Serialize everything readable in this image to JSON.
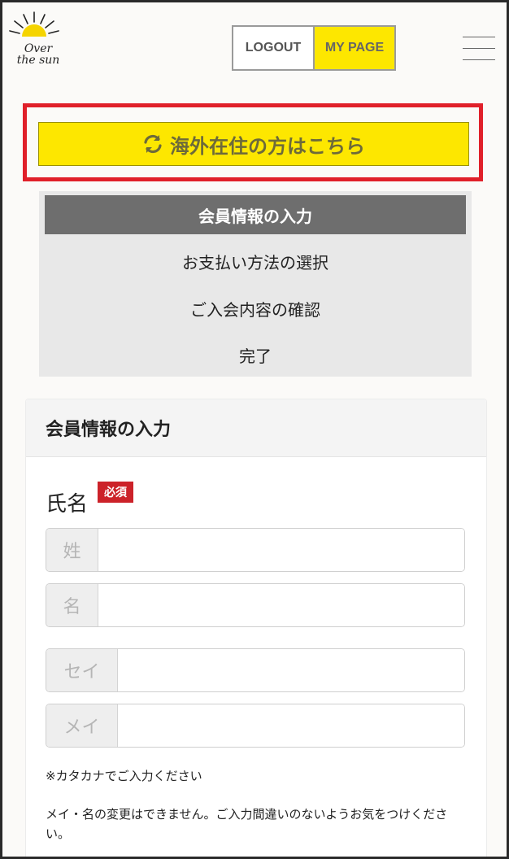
{
  "header": {
    "logo_text": "Over the sun",
    "logout_label": "LOGOUT",
    "mypage_label": "MY PAGE"
  },
  "overseas": {
    "label": "海外在住の方はこちら",
    "icon": "refresh-icon",
    "highlight_color": "#e0202a",
    "button_color": "#fde700"
  },
  "steps": [
    {
      "label": "会員情報の入力",
      "active": true
    },
    {
      "label": "お支払い方法の選択",
      "active": false
    },
    {
      "label": "ご入会内容の確認",
      "active": false
    },
    {
      "label": "完了",
      "active": false
    }
  ],
  "form": {
    "title": "会員情報の入力",
    "name_label": "氏名",
    "required_label": "必須",
    "fields": [
      {
        "addon": "姓",
        "value": ""
      },
      {
        "addon": "名",
        "value": ""
      },
      {
        "addon": "セイ",
        "value": ""
      },
      {
        "addon": "メイ",
        "value": ""
      }
    ],
    "note_katakana": "※カタカナでご入力ください",
    "note_change": "メイ・名の変更はできません。ご入力間違いのないようお気をつけください。"
  }
}
